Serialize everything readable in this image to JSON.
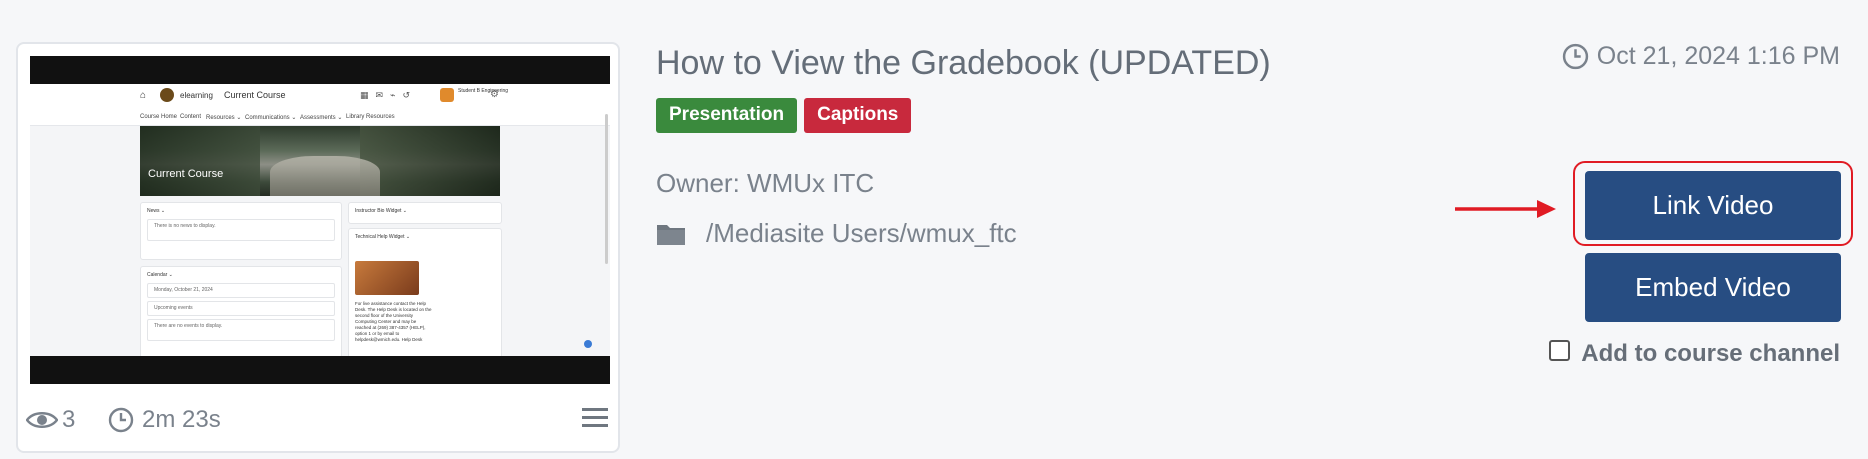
{
  "video": {
    "title": "How to View the Gradebook (UPDATED)",
    "date": "Oct 21, 2024 1:16 PM",
    "tags": [
      {
        "label": "Presentation",
        "color": "#3a8a3d"
      },
      {
        "label": "Captions",
        "color": "#c8293d"
      }
    ],
    "owner": "Owner: WMUx ITC",
    "folder_path": "/Mediasite Users/wmux_ftc",
    "views": "3",
    "duration": "2m 23s"
  },
  "thumbnail": {
    "lms": {
      "brand": "elearning",
      "course_title": "Current Course",
      "nav": [
        "Course Home",
        "Content",
        "Resources ⌄",
        "Communications ⌄",
        "Assessments ⌄",
        "Library Resources"
      ],
      "hero_title": "Current Course",
      "news_title": "News ⌄",
      "news_empty": "There is no news to display.",
      "calendar_title": "Calendar ⌄",
      "calendar_date": "Monday, October 21, 2024",
      "upcoming_title": "Upcoming events",
      "events_empty": "There are no events to display.",
      "widget_title": "Instructor Bio Widget ⌄",
      "help_title": "Technical Help Widget ⌄",
      "help_text": "For live assistance contact the Help Desk. The Help Desk is located on the second floor of the University Computing Center and may be reached at (269) 387-4357 (HELP), option 1 or by email to helpdesk@wmich.edu. Help Desk",
      "user_text": "Student B Engineering"
    }
  },
  "actions": {
    "link_label": "Link Video",
    "embed_label": "Embed Video",
    "add_channel_label": "Add to course channel"
  },
  "icons": {
    "views": "eye-icon",
    "duration": "clock-icon",
    "menu": "menu-lines-icon",
    "date": "clock-icon",
    "folder": "folder-icon",
    "arrow": "red-arrow-icon"
  },
  "colors": {
    "primary_button": "#274d82",
    "highlight": "#e01b24",
    "text": "#646d78"
  }
}
